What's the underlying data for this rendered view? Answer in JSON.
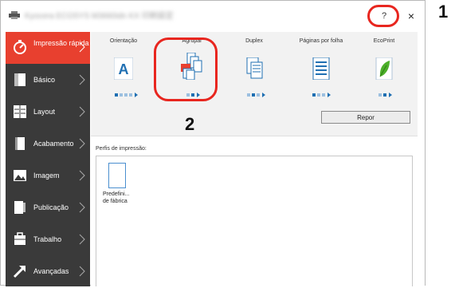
{
  "window": {
    "title": "Kyocera ECOSYS M3660idn KX 印刷設定",
    "help_label": "?",
    "close_label": "×"
  },
  "callouts": {
    "one": "1",
    "two": "2"
  },
  "sidebar": {
    "items": [
      {
        "label": "Impressão rápida",
        "icon": "quick-print-icon",
        "active": true
      },
      {
        "label": "Básico",
        "icon": "basic-icon"
      },
      {
        "label": "Layout",
        "icon": "layout-icon"
      },
      {
        "label": "Acabamento",
        "icon": "finishing-icon"
      },
      {
        "label": "Imagem",
        "icon": "image-icon"
      },
      {
        "label": "Publicação",
        "icon": "publishing-icon"
      },
      {
        "label": "Trabalho",
        "icon": "job-icon"
      },
      {
        "label": "Avançadas",
        "icon": "advanced-icon"
      }
    ]
  },
  "quick_print": {
    "options": [
      {
        "label": "Orientação",
        "icon": "orientation-icon"
      },
      {
        "label": "Agrupar",
        "icon": "collate-icon"
      },
      {
        "label": "Duplex",
        "icon": "duplex-icon"
      },
      {
        "label": "Páginas por folha",
        "icon": "pages-per-sheet-icon"
      },
      {
        "label": "EcoPrint",
        "icon": "ecoprint-icon"
      }
    ],
    "reset_label": "Repor"
  },
  "profiles": {
    "label": "Perfis de impressão:",
    "items": [
      {
        "name_line1": "Predefini...",
        "name_line2": "de fábrica"
      }
    ]
  },
  "colors": {
    "accent": "#e8402f",
    "sidebar_bg": "#3a3a3a",
    "callout": "#e8261f",
    "icon_blue": "#1f6fb2"
  }
}
